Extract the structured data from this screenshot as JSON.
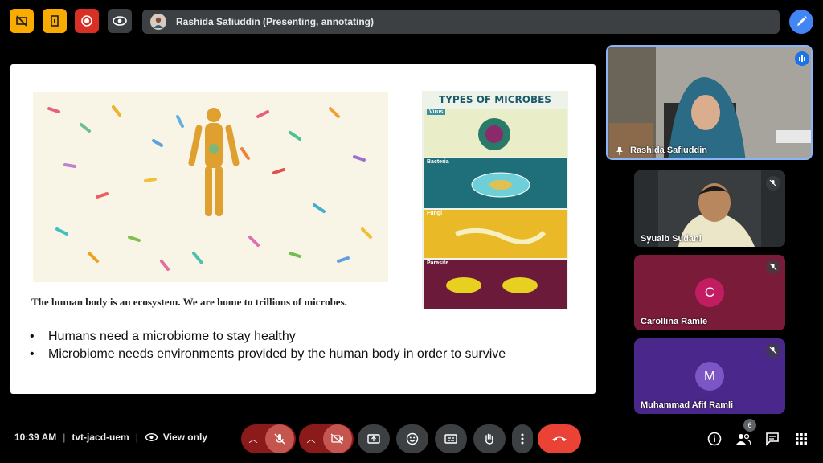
{
  "top_bar": {
    "presenting_label": "Rashida Safiuddin (Presenting, annotating)"
  },
  "slide": {
    "caption": "The human body is an ecosystem. We are home to trillions of microbes.",
    "poster": {
      "title": "TYPES OF MICROBES",
      "sections": [
        "Virus",
        "Bacteria",
        "Fungi",
        "Parasite"
      ]
    },
    "bullets": [
      "Humans need a microbiome to stay healthy",
      "Microbiome needs environments provided by the human body in order to survive"
    ]
  },
  "participants": [
    {
      "name": "Rashida Safiuddin",
      "role": "presenter"
    },
    {
      "name": "Syuaib Sudani",
      "muted": true
    },
    {
      "name": "Carollina Ramle",
      "initial": "C",
      "muted": true,
      "color": "#8e2845"
    },
    {
      "name": "Muhammad Afif Ramli",
      "initial": "M",
      "muted": true,
      "color": "#5b3a9e"
    }
  ],
  "bottom_bar": {
    "time": "10:39 AM",
    "meeting_code": "tvt-jacd-uem",
    "view_mode": "View only",
    "people_count": "6"
  },
  "colors": {
    "accent_blue": "#4285f4",
    "end_call_red": "#ea4335",
    "muted_red": "#8b1a1a",
    "tile_bg": "#3c4043"
  }
}
